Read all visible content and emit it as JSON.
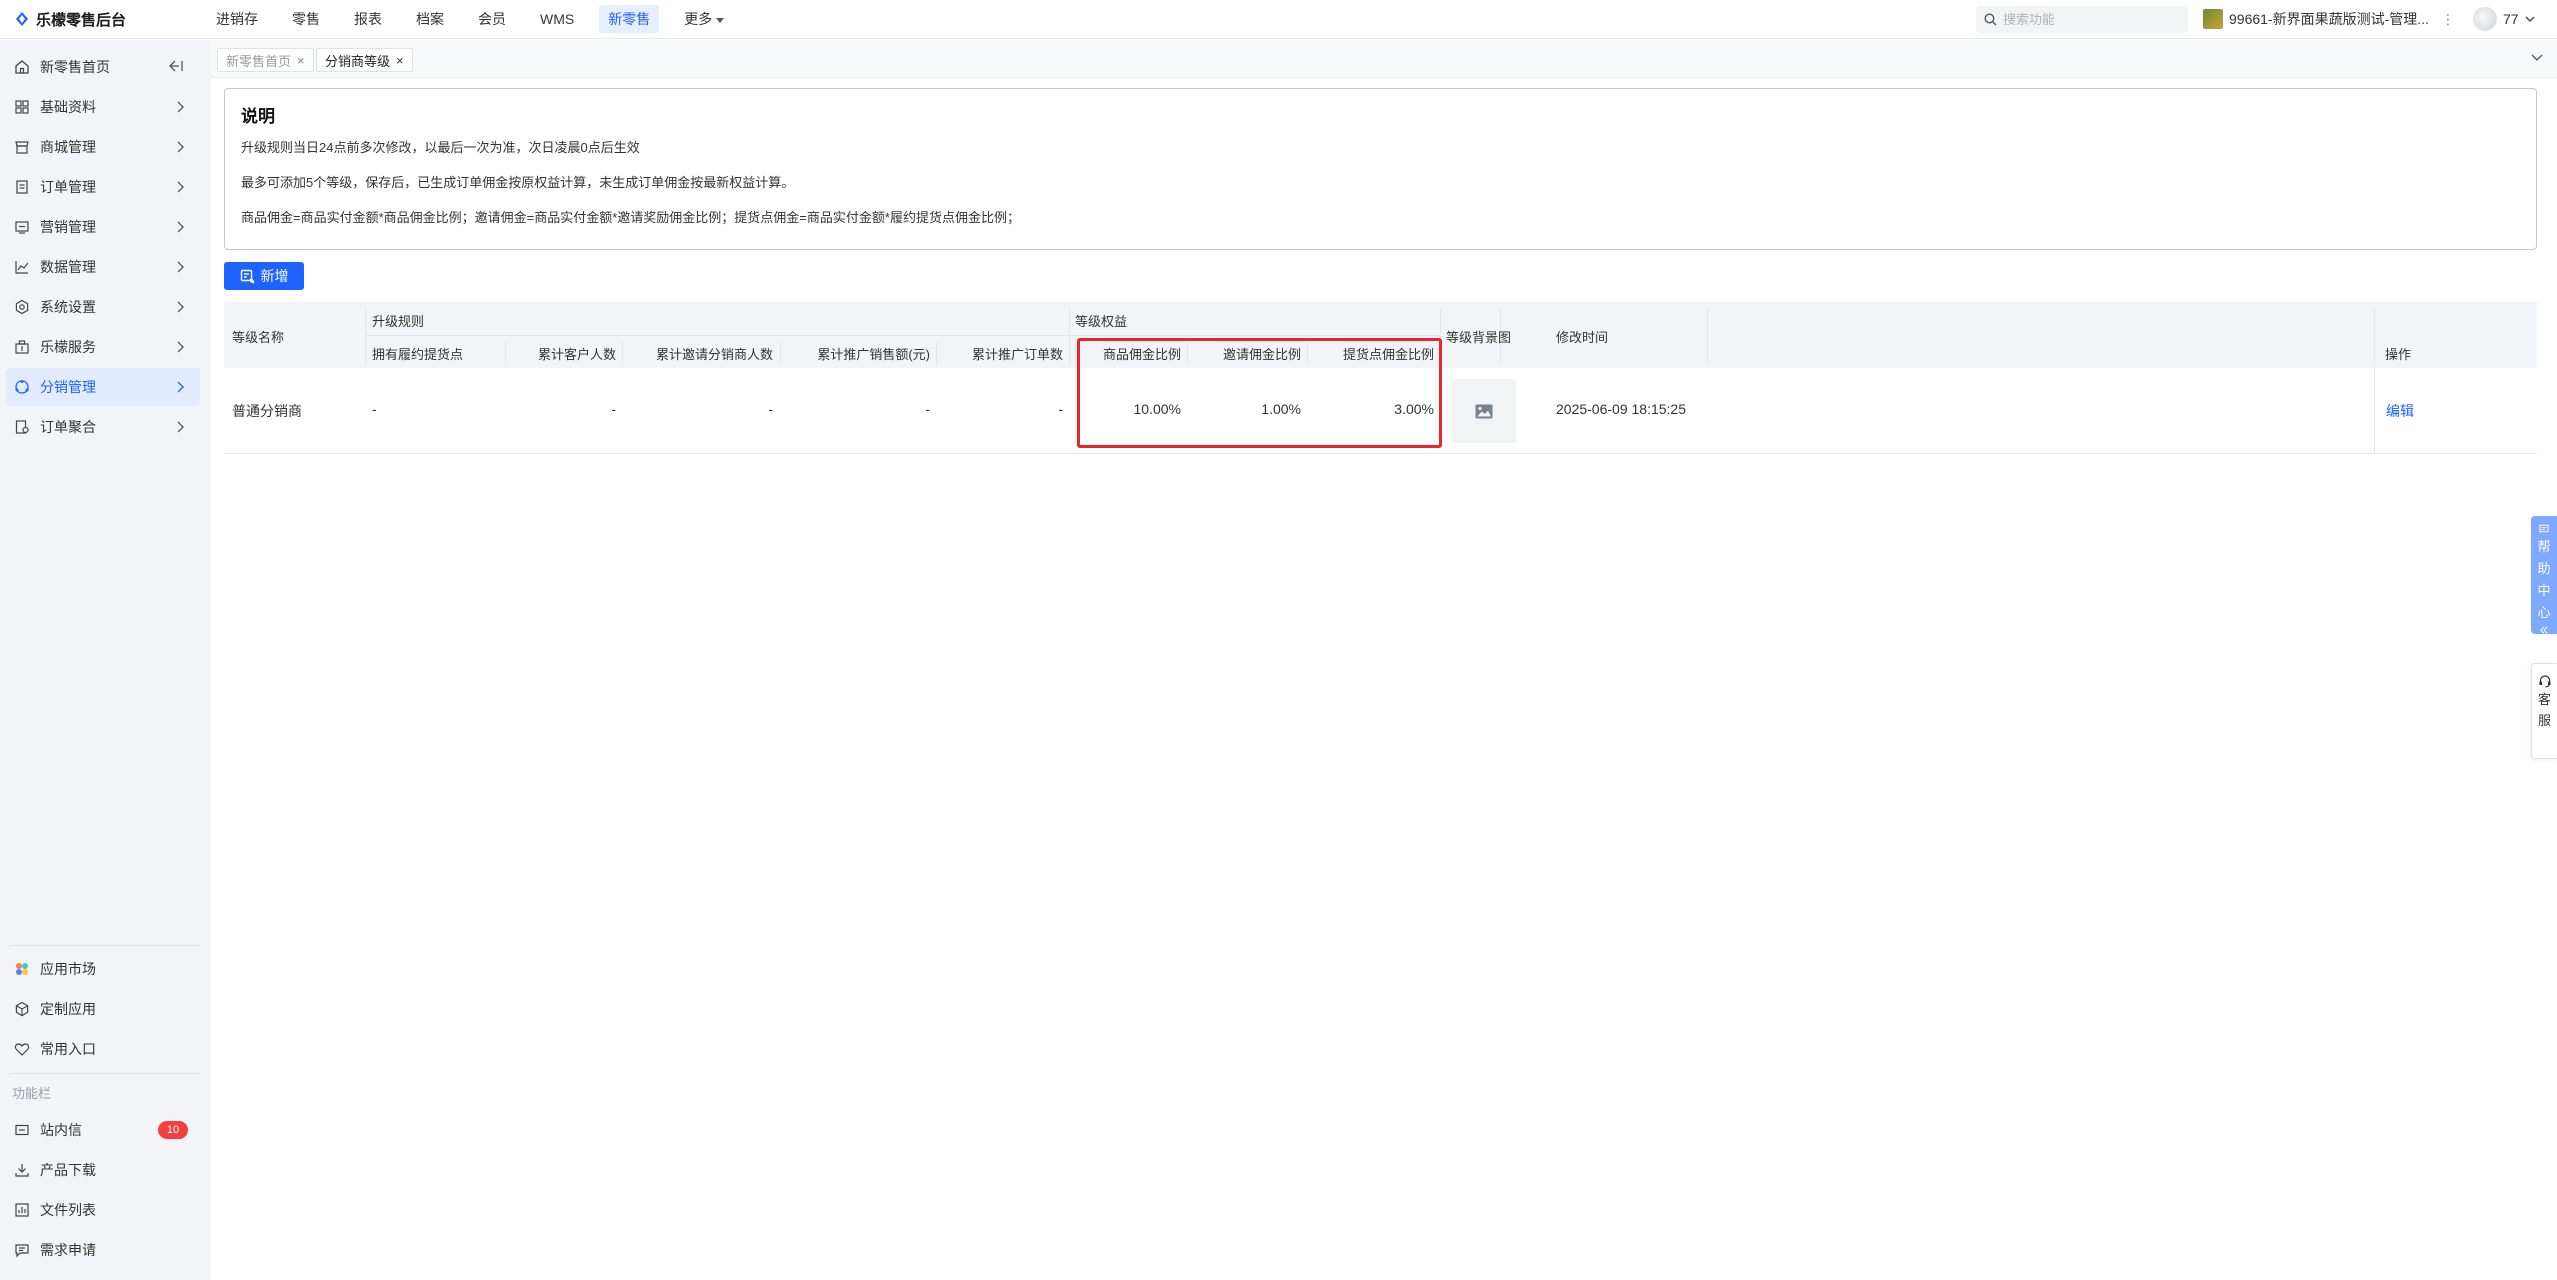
{
  "app": {
    "logo_text": "乐檬零售后台"
  },
  "topnav": {
    "items": [
      "进销存",
      "零售",
      "报表",
      "档案",
      "会员",
      "WMS",
      "新零售"
    ],
    "active_index": 6,
    "more_label": "更多"
  },
  "search": {
    "placeholder": "搜索功能"
  },
  "store": {
    "label": "99661-新界面果蔬版测试-管理...",
    "menu_glyph": "⋮"
  },
  "user": {
    "name": "77"
  },
  "sidebar": {
    "items": [
      {
        "label": "新零售首页",
        "icon": "home-icon"
      },
      {
        "label": "基础资料",
        "icon": "grid-icon"
      },
      {
        "label": "商城管理",
        "icon": "store-icon"
      },
      {
        "label": "订单管理",
        "icon": "order-icon"
      },
      {
        "label": "营销管理",
        "icon": "marketing-icon"
      },
      {
        "label": "数据管理",
        "icon": "chart-icon"
      },
      {
        "label": "系统设置",
        "icon": "settings-icon"
      },
      {
        "label": "乐檬服务",
        "icon": "service-icon"
      },
      {
        "label": "分销管理",
        "icon": "distribution-icon"
      },
      {
        "label": "订单聚合",
        "icon": "order-aggregate-icon"
      }
    ],
    "active_index": 8,
    "bottom_items": [
      {
        "label": "应用市场",
        "icon": "app-market-icon"
      },
      {
        "label": "定制应用",
        "icon": "custom-app-icon"
      },
      {
        "label": "常用入口",
        "icon": "heart-icon"
      }
    ],
    "section_title": "功能栏",
    "function_items": [
      {
        "label": "站内信",
        "icon": "mail-icon",
        "badge": "10"
      },
      {
        "label": "产品下载",
        "icon": "download-icon"
      },
      {
        "label": "文件列表",
        "icon": "file-list-icon"
      },
      {
        "label": "需求申请",
        "icon": "request-icon"
      }
    ]
  },
  "tabs": [
    {
      "label": "新零售首页",
      "close": "×"
    },
    {
      "label": "分销商等级",
      "close": "×"
    }
  ],
  "active_tab": 1,
  "notice": {
    "title": "说明",
    "lines": [
      "升级规则当日24点前多次修改，以最后一次为准，次日凌晨0点后生效",
      "最多可添加5个等级，保存后，已生成订单佣金按原权益计算，未生成订单佣金按最新权益计算。",
      "商品佣金=商品实付金额*商品佣金比例；邀请佣金=商品实付金额*邀请奖励佣金比例；提货点佣金=商品实付金额*履约提货点佣金比例；"
    ]
  },
  "toolbar": {
    "add_label": "新增"
  },
  "table": {
    "headers": {
      "level_name": "等级名称",
      "upgrade_rules": "升级规则",
      "level_benefits": "等级权益",
      "background": "等级背景图",
      "modified_time": "修改时间",
      "actions": "操作"
    },
    "sub_headers": {
      "pickup_points": "拥有履约提货点",
      "customers": "累计客户人数",
      "invited_distributors": "累计邀请分销商人数",
      "sales_amount": "累计推广销售额(元)",
      "order_count": "累计推广订单数",
      "product_commission": "商品佣金比例",
      "invite_commission": "邀请佣金比例",
      "pickup_commission": "提货点佣金比例"
    },
    "rows": [
      {
        "level_name": "普通分销商",
        "pickup_points": "-",
        "customers": "-",
        "invited_distributors": "-",
        "sales_amount": "-",
        "order_count": "-",
        "product_commission": "10.00%",
        "invite_commission": "1.00%",
        "pickup_commission": "3.00%",
        "modified_time": "2025-06-09 18:15:25",
        "action": "编辑"
      }
    ]
  },
  "widgets": {
    "help": [
      "帮",
      "助",
      "中",
      "心"
    ],
    "service": [
      "客",
      "服"
    ]
  },
  "colors": {
    "accent": "#1d63ff",
    "highlight": "#e8262b",
    "badge": "#f53f3f"
  }
}
